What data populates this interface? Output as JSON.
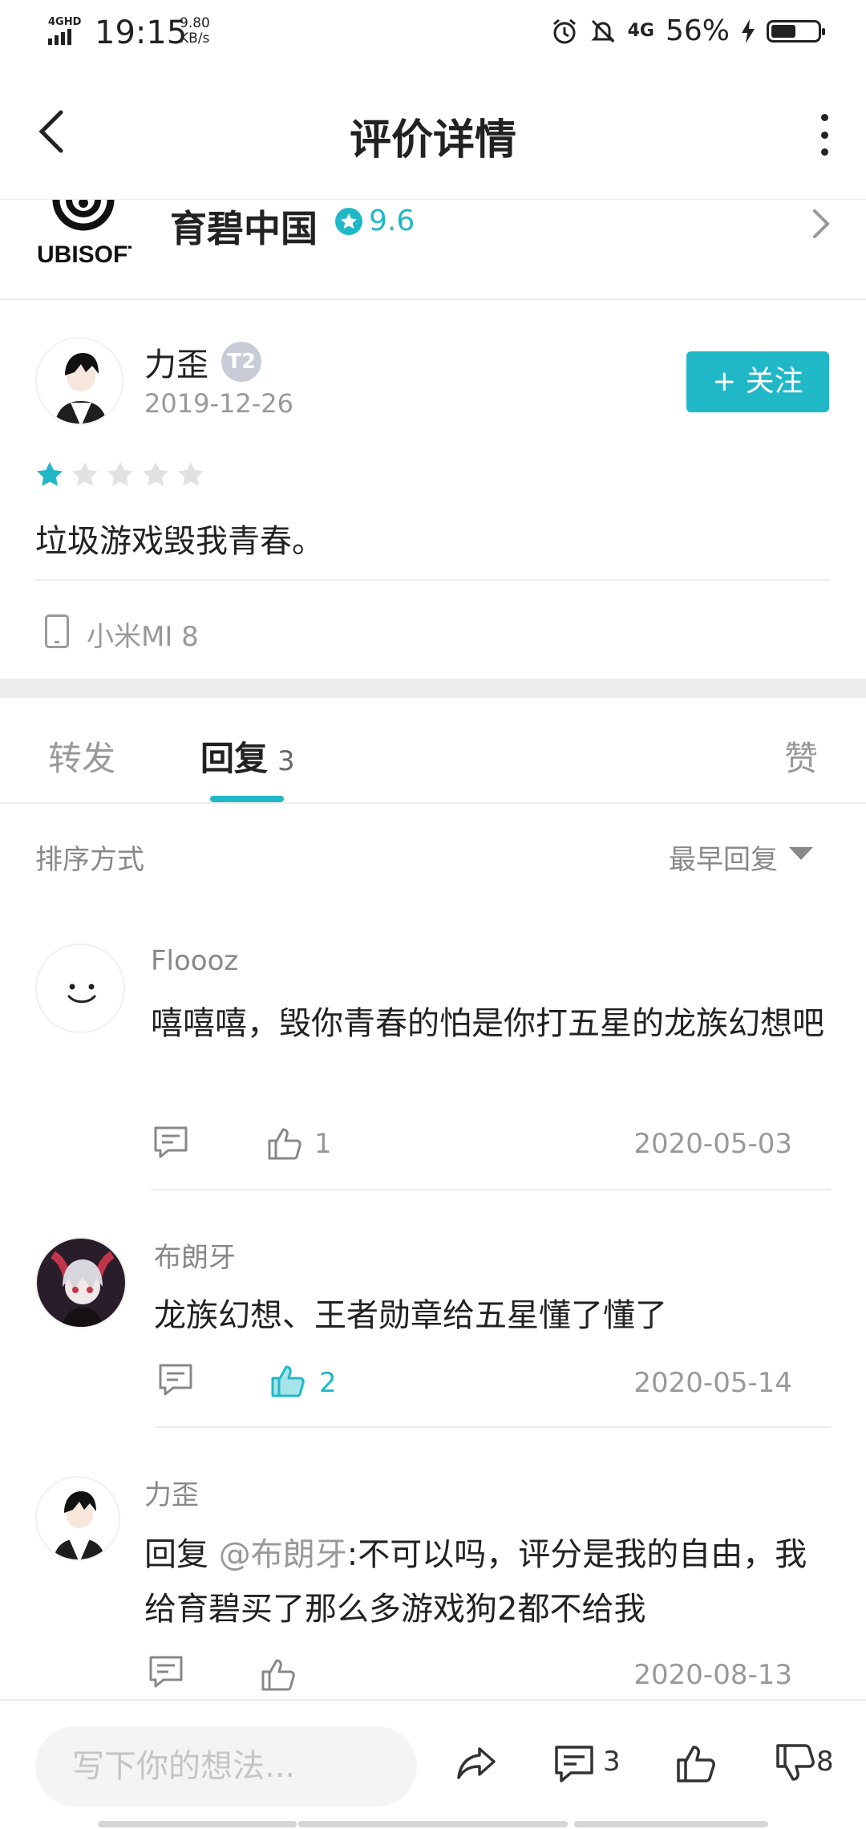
{
  "status_bar": {
    "network": "4GHD",
    "time": "19:15",
    "speed_value": "9.80",
    "speed_unit": "KB/s",
    "net_type": "4G",
    "battery": "56%"
  },
  "header": {
    "title": "评价详情"
  },
  "app": {
    "logo_text": "UBISOFT",
    "name": "育碧中国",
    "score": "9.6"
  },
  "review": {
    "author": "力歪",
    "level": "T2",
    "date": "2019-12-26",
    "follow_label": "+ 关注",
    "rating": 1,
    "max_rating": 5,
    "text": "垃圾游戏毁我青春。",
    "device": "小米MI 8"
  },
  "tabs": {
    "forward": "转发",
    "reply": "回复",
    "reply_count": "3",
    "like": "赞"
  },
  "sort": {
    "label": "排序方式",
    "value": "最早回复"
  },
  "comments": [
    {
      "author": "Floooz",
      "text": "嘻嘻嘻，毁你青春的怕是你打五星的龙族幻想吧",
      "likes": "1",
      "date": "2020-05-03"
    },
    {
      "author": "布朗牙",
      "text": "龙族幻想、王者勋章给五星懂了懂了",
      "likes": "2",
      "date": "2020-05-14"
    },
    {
      "author": "力歪",
      "reply_prefix": "回复 ",
      "mention": "@布朗牙",
      "text": ":不可以吗，评分是我的自由，我给育碧买了那么多游戏狗2都不给我",
      "date": "2020-08-13"
    }
  ],
  "bottom_bar": {
    "input_placeholder": "写下你的想法...",
    "comment_count": "3",
    "dislike_count": "8"
  },
  "colors": {
    "accent": "#20b8c7",
    "text": "#222222",
    "muted": "#999999"
  }
}
